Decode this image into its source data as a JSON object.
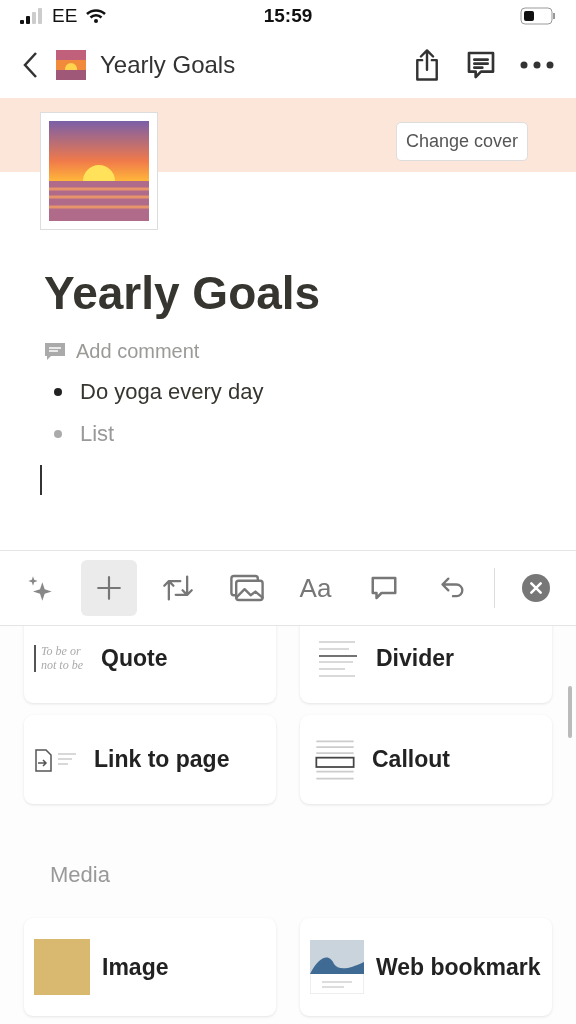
{
  "status_bar": {
    "carrier": "EE",
    "time": "15:59"
  },
  "nav": {
    "title": "Yearly Goals"
  },
  "cover": {
    "button": "Change cover"
  },
  "page": {
    "title": "Yearly Goals",
    "comment_placeholder": "Add comment",
    "bullets": [
      {
        "text": "Do yoga every day",
        "placeholder": false
      },
      {
        "text": "List",
        "placeholder": true
      }
    ]
  },
  "toolbar": [
    {
      "kind": "ai",
      "selected": false
    },
    {
      "kind": "add",
      "selected": true
    },
    {
      "kind": "turn",
      "selected": false
    },
    {
      "kind": "media",
      "selected": false
    },
    {
      "kind": "text",
      "label": "Aa",
      "selected": false
    },
    {
      "kind": "comment",
      "selected": false
    },
    {
      "kind": "undo",
      "selected": false
    },
    {
      "kind": "close",
      "selected": false
    }
  ],
  "blocks": [
    {
      "kind": "quote",
      "label": "Quote",
      "sample": "To be or not to be"
    },
    {
      "kind": "divider",
      "label": "Divider"
    },
    {
      "kind": "link",
      "label": "Link to page"
    },
    {
      "kind": "callout",
      "label": "Callout"
    }
  ],
  "media": {
    "heading": "Media",
    "blocks": [
      {
        "kind": "image",
        "label": "Image"
      },
      {
        "kind": "bookmark",
        "label": "Web bookmark"
      }
    ]
  }
}
